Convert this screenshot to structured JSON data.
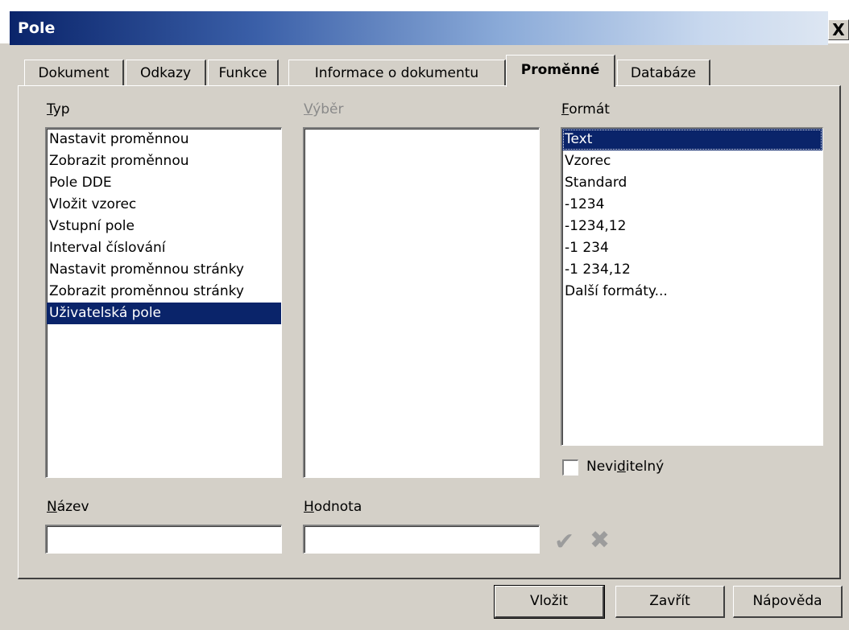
{
  "window": {
    "title": "Pole",
    "close_glyph": "X"
  },
  "tabs": [
    {
      "label": "Dokument"
    },
    {
      "label": "Odkazy"
    },
    {
      "label": "Funkce"
    },
    {
      "label": "Informace o dokumentu"
    },
    {
      "label": "Proměnné",
      "active": true
    },
    {
      "label": "Databáze"
    }
  ],
  "type": {
    "label_first": "T",
    "label_rest": "yp",
    "items": [
      "Nastavit proměnnou",
      "Zobrazit proměnnou",
      "Pole DDE",
      "Vložit vzorec",
      "Vstupní pole",
      "Interval číslování",
      "Nastavit proměnnou stránky",
      "Zobrazit proměnnou stránky",
      "Uživatelská pole"
    ],
    "selected": "Uživatelská pole"
  },
  "selection": {
    "label_first": "V",
    "label_rest": "ýběr"
  },
  "format": {
    "label_first": "F",
    "label_rest": "ormát",
    "items": [
      "Text",
      "Vzorec",
      "Standard",
      "-1234",
      "-1234,12",
      "-1 234",
      "-1 234,12",
      "Další formáty..."
    ],
    "selected": "Text"
  },
  "invisible": {
    "label_a": "Nevi",
    "label_u": "d",
    "label_b": "itelný",
    "checked": false
  },
  "name": {
    "label_first": "N",
    "label_rest": "ázev",
    "value": ""
  },
  "value": {
    "label_first": "H",
    "label_rest": "odnota",
    "value": ""
  },
  "icons": {
    "apply": "check-icon",
    "delete": "delete-x-icon",
    "apply_glyph": "✔",
    "delete_glyph": "✖"
  },
  "buttons": {
    "insert": "Vložit",
    "close": "Zavřít",
    "help": "Nápověda"
  }
}
